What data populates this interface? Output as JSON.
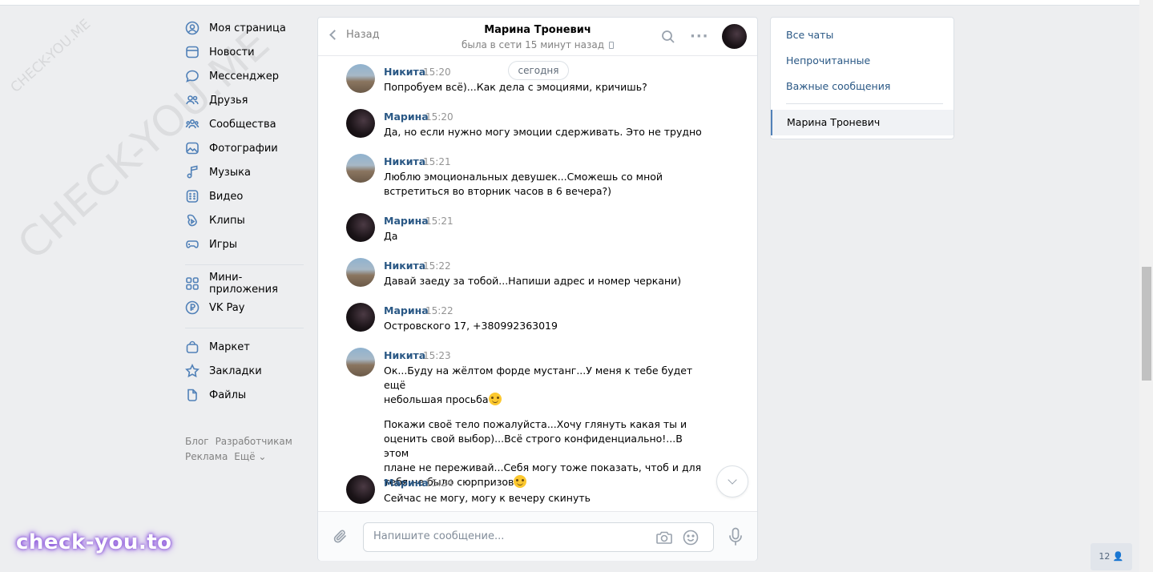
{
  "watermark": {
    "big": "CHECK-YOU.ME",
    "small": "CHECK-YOU.ME",
    "bottom": "check-you.to"
  },
  "nav": {
    "items": [
      {
        "label": "Моя страница"
      },
      {
        "label": "Новости"
      },
      {
        "label": "Мессенджер"
      },
      {
        "label": "Друзья"
      },
      {
        "label": "Сообщества"
      },
      {
        "label": "Фотографии"
      },
      {
        "label": "Музыка"
      },
      {
        "label": "Видео"
      },
      {
        "label": "Клипы"
      },
      {
        "label": "Игры"
      }
    ],
    "items2": [
      {
        "label": "Мини-приложения"
      },
      {
        "label": "VK Pay"
      }
    ],
    "items3": [
      {
        "label": "Маркет"
      },
      {
        "label": "Закладки"
      },
      {
        "label": "Файлы"
      }
    ],
    "footer": {
      "blog": "Блог",
      "dev": "Разработчикам",
      "ads": "Реклама",
      "more": "Ещё ⌄"
    }
  },
  "chat": {
    "back_label": "Назад",
    "title": "Марина Троневич",
    "status": "была в сети 15 минут назад",
    "today": "сегодня",
    "messages": [
      {
        "name": "Никита",
        "time": "15:20",
        "lines": [
          "Попробуем всё)...Как дела с эмоциями, кричишь?"
        ]
      },
      {
        "name": "Марина",
        "time": "15:20",
        "lines": [
          "Да, но если нужно могу эмоции сдерживать. Это не трудно"
        ]
      },
      {
        "name": "Никита",
        "time": "15:21",
        "lines": [
          "Люблю эмоциональных девушек...Сможешь со мной",
          "встретиться во вторник часов в 6 вечера?)"
        ]
      },
      {
        "name": "Марина",
        "time": "15:21",
        "lines": [
          "Да"
        ]
      },
      {
        "name": "Никита",
        "time": "15:22",
        "lines": [
          "Давай заеду за тобой...Напиши адрес и номер черкани)"
        ]
      },
      {
        "name": "Марина",
        "time": "15:22",
        "lines": [
          "Островского 17, +380992363019"
        ]
      },
      {
        "name": "Никита",
        "time": "15:23",
        "lines": [
          "Ок...Буду на жёлтом форде мустанг...У меня к тебе будет ещё",
          "небольшая просьба"
        ],
        "extra": [
          "Покажи своё тело пожалуйста...Хочу глянуть какая ты и",
          "оценить свой выбор)...Всё строго конфиденциально!...В этом",
          "плане не переживай...Себя могу тоже показать, чтоб и для",
          "тебя не было сюрпризов"
        ]
      },
      {
        "name": "Марина",
        "time": "15:24",
        "lines": [
          "Сейчас не могу, могу к вечеру скинуть"
        ]
      }
    ],
    "composer_placeholder": "Напишите сообщение..."
  },
  "right": {
    "all": "Все чаты",
    "unread": "Непрочитанные",
    "important": "Важные сообщения",
    "active": "Марина Троневич"
  },
  "badge": "12"
}
